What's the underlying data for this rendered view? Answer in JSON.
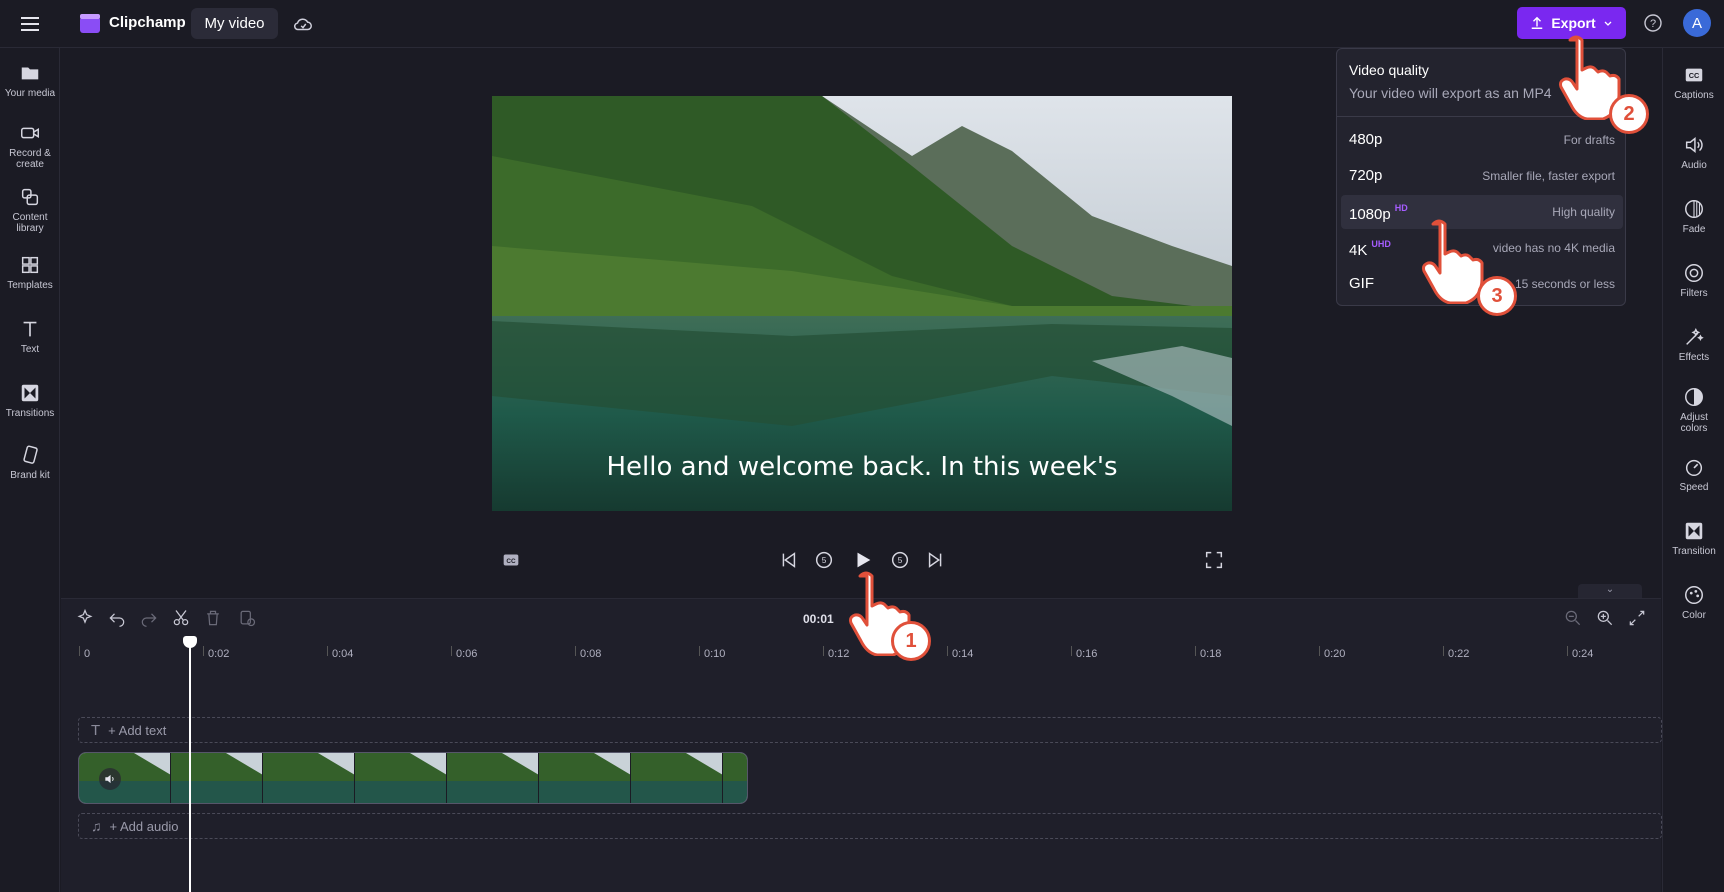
{
  "app": {
    "brand": "Clipchamp",
    "project_title": "My video"
  },
  "header": {
    "export_label": "Export",
    "avatar_initial": "A"
  },
  "left_sidebar": {
    "items": [
      {
        "label": "Your media",
        "icon": "folder-icon"
      },
      {
        "label": "Record & create",
        "icon": "camera-icon"
      },
      {
        "label": "Content library",
        "icon": "library-icon"
      },
      {
        "label": "Templates",
        "icon": "templates-icon"
      },
      {
        "label": "Text",
        "icon": "text-icon"
      },
      {
        "label": "Transitions",
        "icon": "transitions-icon"
      },
      {
        "label": "Brand kit",
        "icon": "brand-kit-icon"
      }
    ]
  },
  "right_sidebar": {
    "items": [
      {
        "label": "Captions",
        "icon": "captions-icon"
      },
      {
        "label": "Audio",
        "icon": "audio-icon"
      },
      {
        "label": "Fade",
        "icon": "fade-icon"
      },
      {
        "label": "Filters",
        "icon": "filters-icon"
      },
      {
        "label": "Effects",
        "icon": "effects-icon"
      },
      {
        "label": "Adjust colors",
        "icon": "adjust-colors-icon"
      },
      {
        "label": "Speed",
        "icon": "speed-icon"
      },
      {
        "label": "Transition",
        "icon": "transition-icon"
      },
      {
        "label": "Color",
        "icon": "color-icon"
      }
    ]
  },
  "preview": {
    "caption_text": "Hello and welcome back. In this week's"
  },
  "timeline": {
    "timecode": "00:01",
    "ticks": [
      "0",
      "0:02",
      "0:04",
      "0:06",
      "0:08",
      "0:10",
      "0:12",
      "0:14",
      "0:16",
      "0:18",
      "0:20",
      "0:22",
      "0:24"
    ],
    "add_text": "+ Add text",
    "add_audio": "+ Add audio"
  },
  "export_menu": {
    "title": "Video quality",
    "subtitle": "Your video will export as an MP4",
    "options": [
      {
        "name": "480p",
        "badge": "",
        "desc": "For drafts",
        "selected": false
      },
      {
        "name": "720p",
        "badge": "",
        "desc": "Smaller file, faster export",
        "selected": false
      },
      {
        "name": "1080p",
        "badge": "HD",
        "desc": "High quality",
        "selected": true
      },
      {
        "name": "4K",
        "badge": "UHD",
        "desc": "video has no 4K media",
        "selected": false
      },
      {
        "name": "GIF",
        "badge": "",
        "desc": "15 seconds or less",
        "selected": false
      }
    ]
  },
  "annotations": {
    "step1": "1",
    "step2": "2",
    "step3": "3"
  },
  "colors": {
    "accent": "#7a28f0",
    "background": "#1b1b24",
    "badge_ring": "#e0503a"
  }
}
